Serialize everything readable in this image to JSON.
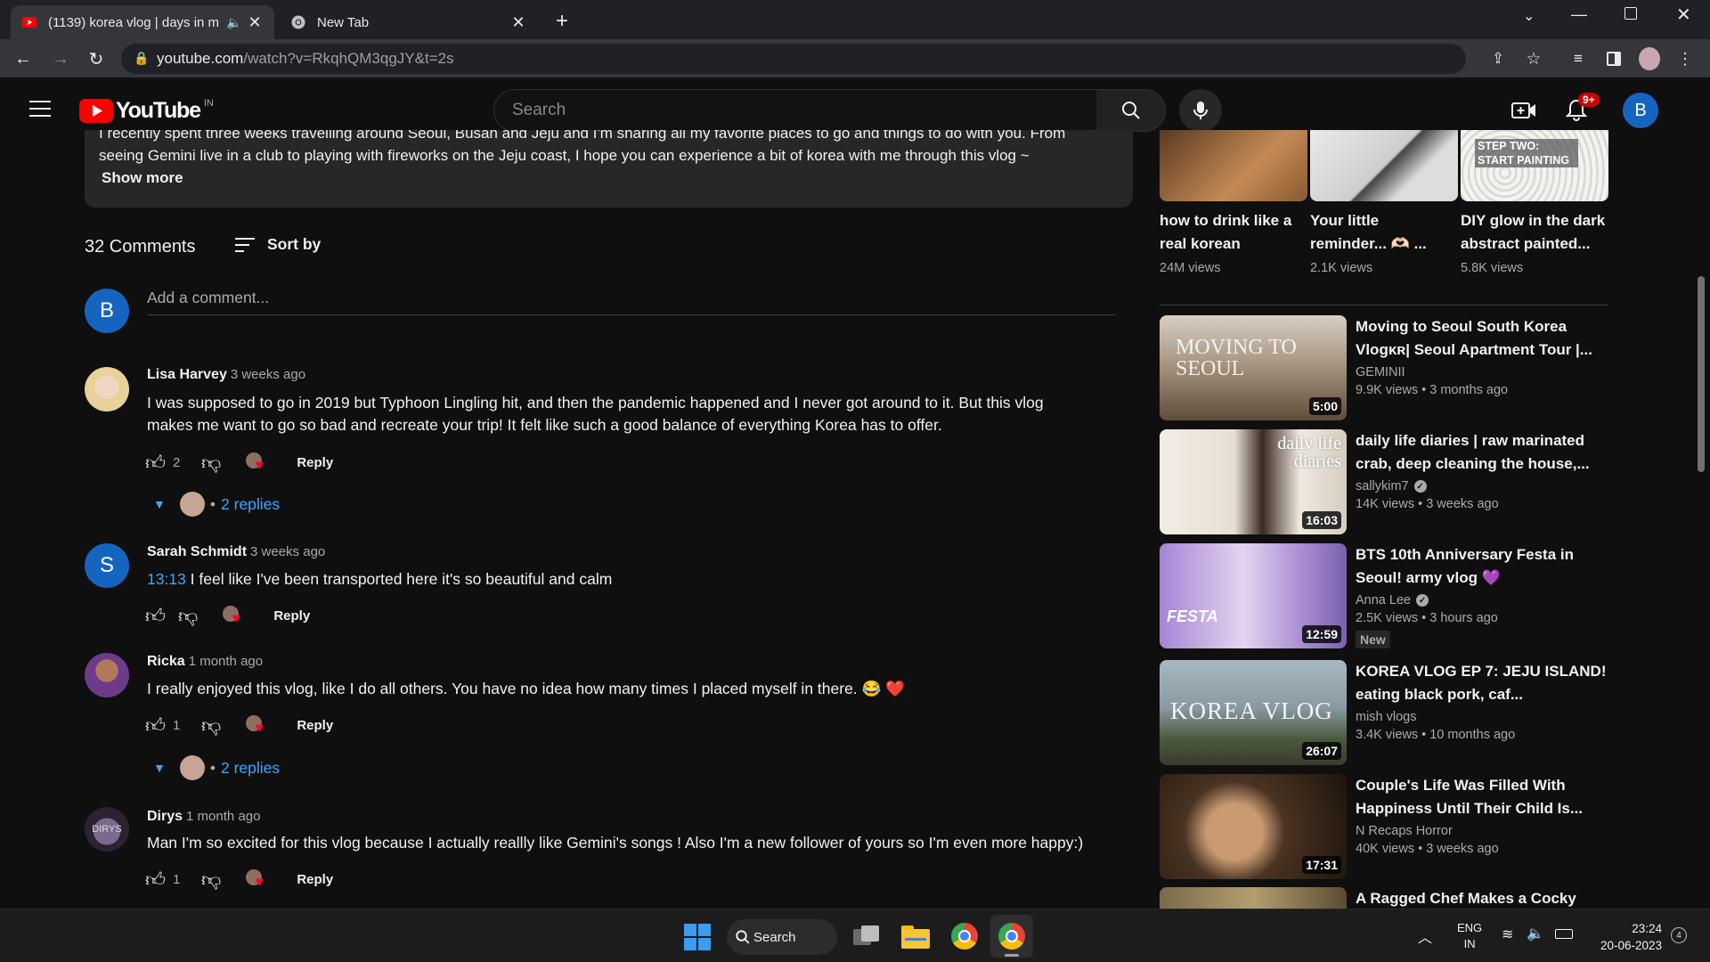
{
  "browser": {
    "tabs": [
      {
        "title": "(1139) korea vlog | days in m",
        "active": true,
        "favicon": "youtube-icon"
      },
      {
        "title": "New Tab",
        "active": false,
        "favicon": "chrome-icon"
      }
    ],
    "url_host": "youtube.com",
    "url_path": "/watch?v=RkqhQM3qgJY&t=2s"
  },
  "header": {
    "logo_text": "YouTube",
    "region": "IN",
    "search_placeholder": "Search",
    "notifications_badge": "9+",
    "account_initial": "B"
  },
  "description": {
    "line1": "I recently spent three weeks travelling around Seoul, Busan and Jeju and I'm sharing all my favorite places to go and things to do with you. From",
    "line2": "seeing Gemini live in a club to playing with fireworks on the Jeju coast, I hope you can experience a bit of korea with me through this vlog ~",
    "show_more": "Show more"
  },
  "comments_section": {
    "count_label": "32 Comments",
    "sort_label": "Sort by",
    "add_placeholder": "Add a comment...",
    "user_initial": "B",
    "comments": [
      {
        "author": "Lisa Harvey",
        "time": "3 weeks ago",
        "line1": "I was supposed to go in 2019 but Typhoon Lingling hit, and then the pandemic happened and I never got around to it. But this vlog",
        "line2": "makes me want to go so bad and recreate your trip! It felt like such a good balance of everything Korea has to offer.",
        "likes": "2",
        "reply": "Reply",
        "replies": "2 replies"
      },
      {
        "author": "Sarah Schmidt",
        "time": "3 weeks ago",
        "timestamp_link": "13:13",
        "line1": " I feel like I've been transported here it's so beautiful and calm",
        "likes": "",
        "reply": "Reply",
        "avatar_initial": "S"
      },
      {
        "author": "Ricka",
        "time": "1 month ago",
        "line1": "I really enjoyed this vlog, like I do all others. You have no idea how many times I placed myself in there. 😂 ❤️",
        "likes": "1",
        "reply": "Reply",
        "replies": "2 replies"
      },
      {
        "author": "Dirys",
        "time": "1 month ago",
        "line1": "Man I'm so excited for this vlog because I actually reallly like Gemini's songs ! Also I'm a new follower of yours so I'm even more happy:)",
        "likes": "1",
        "reply": "Reply"
      }
    ]
  },
  "shorts": [
    {
      "title": "how to drink like a real korean",
      "views": "24M views"
    },
    {
      "title": "Your little reminder... 🫶🏻 ...",
      "views": "2.1K views"
    },
    {
      "title": "DIY glow in the dark abstract painted...",
      "views": "5.8K views",
      "overlay": "STEP TWO: START PAINTING"
    }
  ],
  "recommendations": [
    {
      "title": "Moving to Seoul South Korea Vlogᴋʀ| Seoul Apartment Tour |...",
      "channel": "GEMINII",
      "verified": false,
      "meta": "9.9K views • 3 months ago",
      "duration": "5:00",
      "thumb_text": "MOVING TO SEOUL",
      "thumb_color": "#6b5a48"
    },
    {
      "title": "daily life diaries | raw marinated crab, deep cleaning the house,...",
      "channel": "sallykim7",
      "verified": true,
      "meta": "14K views • 3 weeks ago",
      "duration": "16:03",
      "thumb_text": "daily life diaries",
      "thumb_color": "#d9d2c8"
    },
    {
      "title": "BTS 10th Anniversary Festa in Seoul! army vlog 💜",
      "channel": "Anna Lee",
      "verified": true,
      "meta": "2.5K views • 3 hours ago",
      "duration": "12:59",
      "badge": "New",
      "thumb_text": "FESTA",
      "thumb_color": "#b79bd6"
    },
    {
      "title": "KOREA VLOG EP 7: JEJU ISLAND! eating black pork, caf...",
      "channel": "mish vlogs",
      "verified": false,
      "meta": "3.4K views • 10 months ago",
      "duration": "26:07",
      "thumb_text": "KOREA VLOG",
      "thumb_color": "#7f8d93"
    },
    {
      "title": "Couple's Life Was Filled With Happiness Until Their Child Is...",
      "channel": "N Recaps Horror",
      "verified": false,
      "meta": "40K views • 3 weeks ago",
      "duration": "17:31",
      "thumb_color": "#3b2a1c"
    },
    {
      "title": "A Ragged Chef Makes a Cocky",
      "thumb_color": "#5b4b33"
    }
  ],
  "taskbar": {
    "search_label": "Search",
    "lang_line1": "ENG",
    "lang_line2": "IN",
    "time": "23:24",
    "date": "20-06-2023",
    "notification_count": "4"
  }
}
